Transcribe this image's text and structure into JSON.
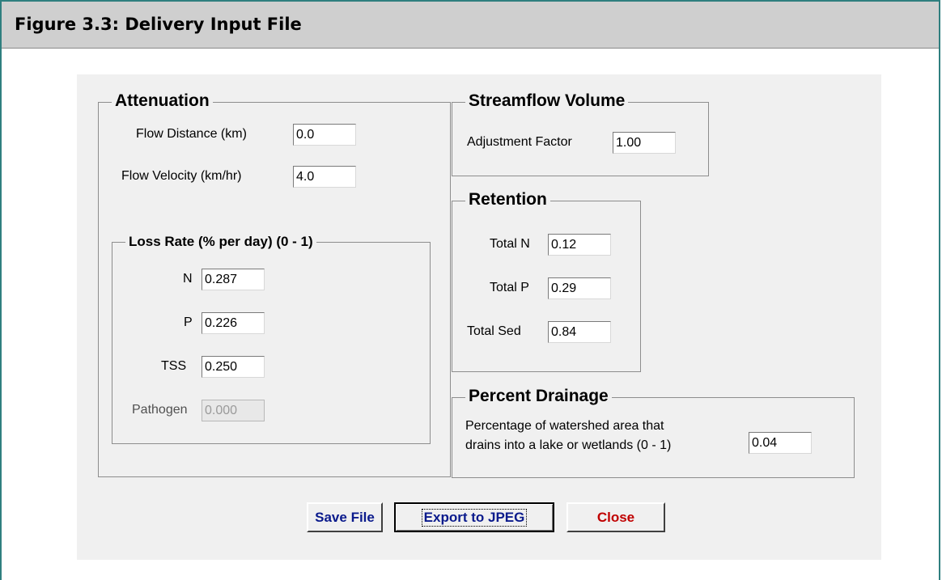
{
  "figure": {
    "title": "Figure 3.3: Delivery Input File"
  },
  "attenuation": {
    "legend": "Attenuation",
    "flow_distance": {
      "label": "Flow Distance (km)",
      "value": "0.0"
    },
    "flow_velocity": {
      "label": "Flow Velocity (km/hr)",
      "value": "4.0"
    },
    "loss_rate": {
      "legend": "Loss Rate (% per day) (0 - 1)",
      "n": {
        "label": "N",
        "value": "0.287"
      },
      "p": {
        "label": "P",
        "value": "0.226"
      },
      "tss": {
        "label": "TSS",
        "value": "0.250"
      },
      "pathogen": {
        "label": "Pathogen",
        "value": "0.000"
      }
    }
  },
  "streamflow": {
    "legend": "Streamflow Volume",
    "adjustment_factor": {
      "label": "Adjustment Factor",
      "value": "1.00"
    }
  },
  "retention": {
    "legend": "Retention",
    "total_n": {
      "label": "Total N",
      "value": "0.12"
    },
    "total_p": {
      "label": "Total P",
      "value": "0.29"
    },
    "total_sed": {
      "label": "Total Sed",
      "value": "0.84"
    }
  },
  "percent_drainage": {
    "legend": "Percent Drainage",
    "label_line1": "Percentage of watershed area that",
    "label_line2": "drains into a lake or wetlands (0 - 1)",
    "value": "0.04"
  },
  "buttons": {
    "save": {
      "label": "Save File",
      "color": "#0a1a8c"
    },
    "export": {
      "label": "Export to JPEG",
      "color": "#0a1a8c"
    },
    "close": {
      "label": "Close",
      "color": "#c00000"
    }
  }
}
